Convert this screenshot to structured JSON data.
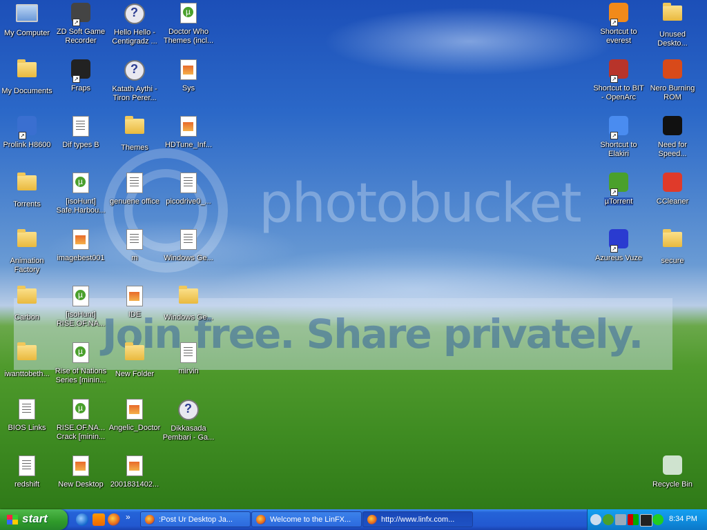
{
  "desktop": {
    "left_icons": [
      {
        "label": "My Computer",
        "icon": "computer-icon"
      },
      {
        "label": "ZD Soft Game Recorder",
        "icon": "camera-icon",
        "shortcut": true
      },
      {
        "label": "Hello Hello - Centigradz ...",
        "icon": "realplayer-media-icon"
      },
      {
        "label": "Doctor Who Themes (incl...",
        "icon": "torrent-file-icon"
      },
      {
        "label": "My Documents",
        "icon": "documents-folder-icon"
      },
      {
        "label": "Fraps",
        "icon": "fraps-icon",
        "shortcut": true
      },
      {
        "label": "Katath Aythi - Tiron Perer...",
        "icon": "realplayer-media-icon"
      },
      {
        "label": "Sys",
        "icon": "image-file-icon"
      },
      {
        "label": "Prolink H8600",
        "icon": "network-icon",
        "shortcut": true
      },
      {
        "label": "Dif types B",
        "icon": "text-file-icon"
      },
      {
        "label": "Themes",
        "icon": "folder-icon"
      },
      {
        "label": "HDTune_Inf...",
        "icon": "image-file-icon"
      },
      {
        "label": "Torrents",
        "icon": "folder-icon"
      },
      {
        "label": "[isoHunt] Safe.Harbou...",
        "icon": "torrent-file-icon"
      },
      {
        "label": "genuene office",
        "icon": "text-file-icon"
      },
      {
        "label": "picodrive0_...",
        "icon": "archive-icon"
      },
      {
        "label": "Animation Factory",
        "icon": "folder-icon"
      },
      {
        "label": "imagebest001",
        "icon": "image-file-icon"
      },
      {
        "label": "m",
        "icon": "text-file-icon"
      },
      {
        "label": "Windows Ge...",
        "icon": "archive-icon"
      },
      {
        "label": "Carbon",
        "icon": "folder-icon"
      },
      {
        "label": "[isoHunt] RISE.OF.NA...",
        "icon": "torrent-file-icon"
      },
      {
        "label": "IDE",
        "icon": "image-file-icon"
      },
      {
        "label": "Windows Ge...",
        "icon": "folder-icon"
      },
      {
        "label": "iwanttobeth...",
        "icon": "folder-icon"
      },
      {
        "label": "Rise of Nations Series [minin...",
        "icon": "torrent-file-icon"
      },
      {
        "label": "New Folder",
        "icon": "folder-icon"
      },
      {
        "label": "mirvin",
        "icon": "text-file-icon"
      },
      {
        "label": "BIOS Links",
        "icon": "text-file-icon"
      },
      {
        "label": "RISE.OF.NA... Crack [minin...",
        "icon": "torrent-file-icon"
      },
      {
        "label": "Angelic_Doctor",
        "icon": "image-file-icon"
      },
      {
        "label": "Dikkasada Pembari - Ga...",
        "icon": "realplayer-media-icon"
      },
      {
        "label": "redshift",
        "icon": "text-file-icon"
      },
      {
        "label": "New Desktop",
        "icon": "image-file-icon"
      },
      {
        "label": "2001831402...",
        "icon": "image-file-icon"
      }
    ],
    "right_icons": [
      {
        "label": "Shortcut to everest",
        "icon": "info-icon",
        "shortcut": true
      },
      {
        "label": "Unused Deskto...",
        "icon": "folder-icon"
      },
      {
        "label": "Shortcut to BIT - OpenArc",
        "icon": "openarc-icon",
        "shortcut": true
      },
      {
        "label": "Nero Burning ROM",
        "icon": "nero-icon"
      },
      {
        "label": "Shortcut to Elakiri",
        "icon": "msn-butterfly-icon",
        "shortcut": true
      },
      {
        "label": "Need for Speed...",
        "icon": "nfs-icon"
      },
      {
        "label": "µTorrent",
        "icon": "utorrent-icon",
        "shortcut": true,
        "selected": true
      },
      {
        "label": "CCleaner",
        "icon": "ccleaner-icon"
      },
      {
        "label": "Azureus Vuze",
        "icon": "azureus-frog-icon",
        "shortcut": true
      },
      {
        "label": "secure",
        "icon": "folder-icon"
      },
      {
        "label": "Recycle Bin",
        "icon": "recycle-bin-icon"
      }
    ],
    "watermark_text": "photobucket",
    "banner_text": "Join free. Share privately."
  },
  "taskbar": {
    "start_label": "start",
    "quick_launch": [
      "ie-icon",
      "vlc-icon",
      "firefox-icon"
    ],
    "tasks": [
      {
        "label": ":Post Ur Desktop Ja...",
        "active": false
      },
      {
        "label": "Welcome to the LinFX...",
        "active": false
      },
      {
        "label": "http://www.linfx.com...",
        "active": true
      }
    ],
    "clock": "8:34 PM"
  }
}
